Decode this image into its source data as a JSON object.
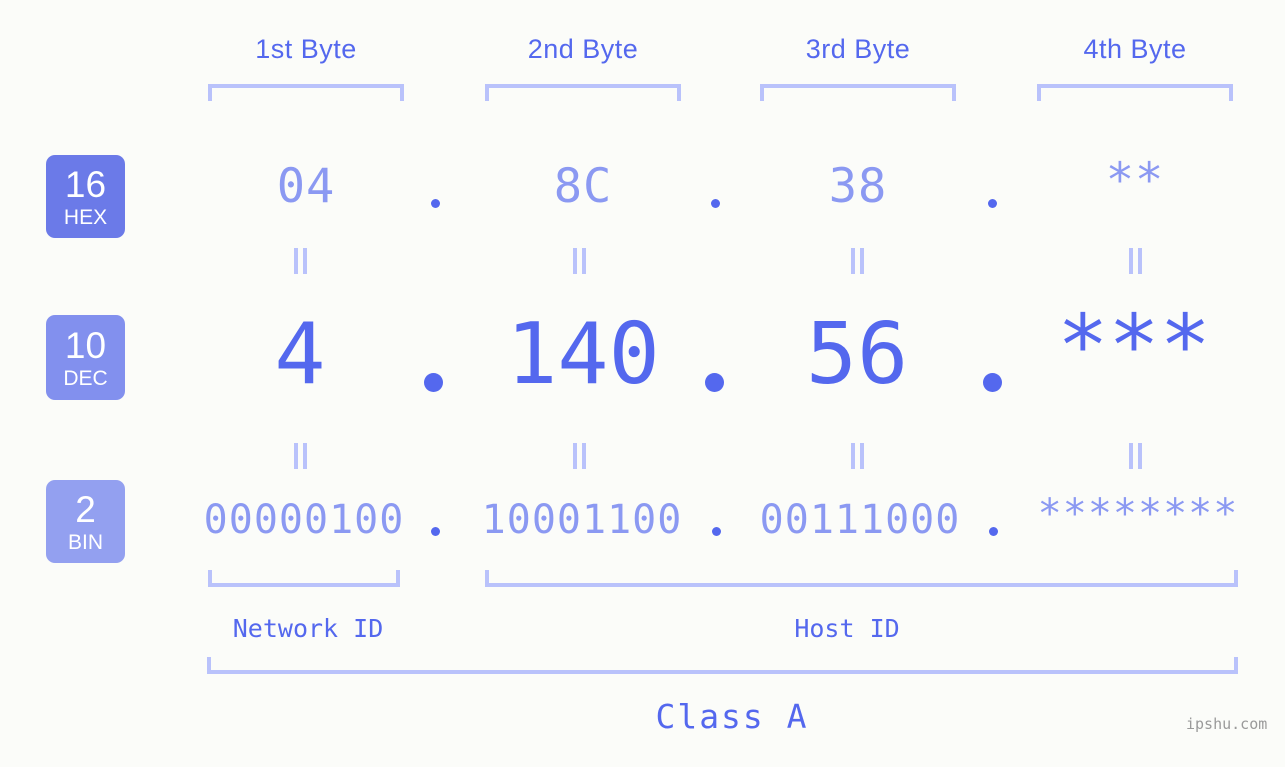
{
  "background_color": "#fbfcf9",
  "accent_color": "#5468ee",
  "accent_light_color": "#8b99f2",
  "bracket_color": "#b9c2fb",
  "byte_headers": [
    {
      "label": "1st Byte",
      "center": 306
    },
    {
      "label": "2nd Byte",
      "center": 583
    },
    {
      "label": "3rd Byte",
      "center": 858
    },
    {
      "label": "4th Byte",
      "center": 1135
    }
  ],
  "rows": [
    {
      "id": "hex",
      "badge": {
        "number": "16",
        "name": "HEX",
        "color": "#6b7ae8"
      },
      "values": [
        "04",
        "8C",
        "38",
        "**"
      ],
      "separator": "."
    },
    {
      "id": "dec",
      "badge": {
        "number": "10",
        "name": "DEC",
        "color": "#8290ee"
      },
      "values": [
        "4",
        "140",
        "56",
        "***"
      ],
      "separator": "."
    },
    {
      "id": "bin",
      "badge": {
        "number": "2",
        "name": "BIN",
        "color": "#93a0f0"
      },
      "values": [
        "00000100",
        "10001100",
        "00111000",
        "********"
      ],
      "separator": "."
    }
  ],
  "segments": [
    {
      "label": "Network ID",
      "center": 308
    },
    {
      "label": "Host ID",
      "center": 847
    }
  ],
  "class": {
    "label": "Class A",
    "center": 732
  },
  "watermark": "ipshu.com"
}
